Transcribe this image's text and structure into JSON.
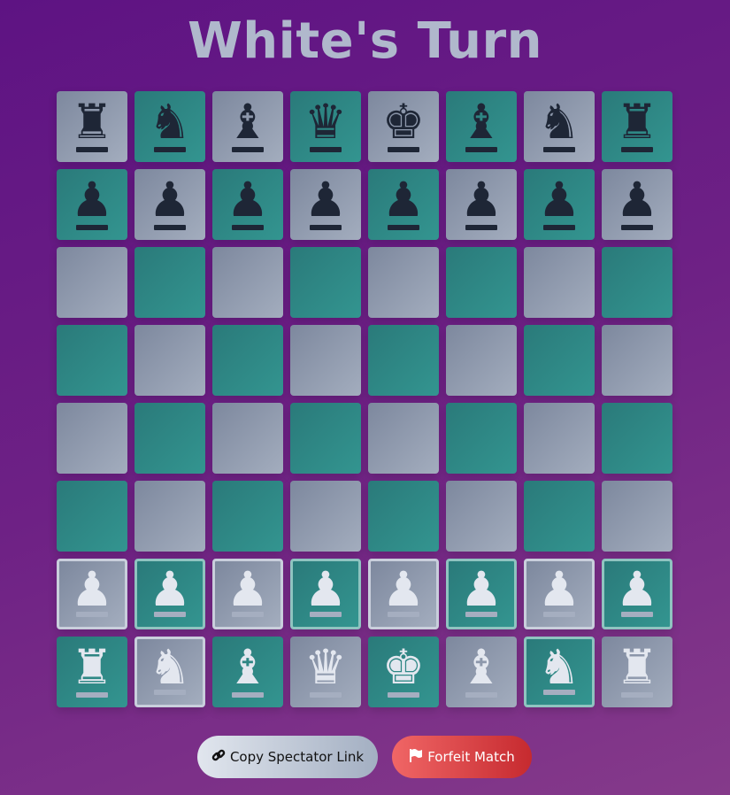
{
  "title": "White's Turn",
  "board": [
    [
      "br",
      "bn",
      "bb",
      "bq",
      "bk",
      "bb",
      "bn",
      "br"
    ],
    [
      "bp",
      "bp",
      "bp",
      "bp",
      "bp",
      "bp",
      "bp",
      "bp"
    ],
    [
      "",
      "",
      "",
      "",
      "",
      "",
      "",
      ""
    ],
    [
      "",
      "",
      "",
      "",
      "",
      "",
      "",
      ""
    ],
    [
      "",
      "",
      "",
      "",
      "",
      "",
      "",
      ""
    ],
    [
      "",
      "",
      "",
      "",
      "",
      "",
      "",
      ""
    ],
    [
      "wp",
      "wp",
      "wp",
      "wp",
      "wp",
      "wp",
      "wp",
      "wp"
    ],
    [
      "wr",
      "wn",
      "wb",
      "wq",
      "wk",
      "wb",
      "wn",
      "wr"
    ]
  ],
  "movable": [
    "a2",
    "b2",
    "c2",
    "d2",
    "e2",
    "f2",
    "g2",
    "h2",
    "b1",
    "g1"
  ],
  "buttons": {
    "copy_link": "Copy Spectator Link",
    "forfeit": "Forfeit Match"
  },
  "icons": {
    "copy_link": "link-icon",
    "forfeit": "flag-icon"
  },
  "colors": {
    "light_square": "#8f99ac",
    "dark_square": "#2e8785",
    "forfeit": "#e04848"
  }
}
